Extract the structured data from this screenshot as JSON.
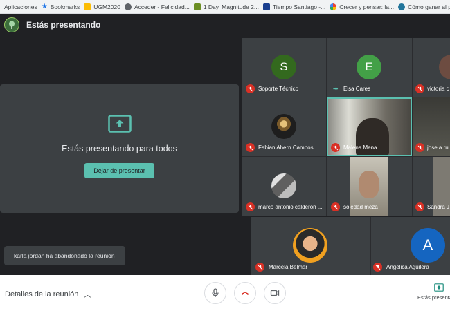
{
  "bookmarks": [
    {
      "label": "Aplicaciones",
      "icon": "apps-grid-icon"
    },
    {
      "label": "Bookmarks",
      "icon": "star-icon"
    },
    {
      "label": "UGM2020",
      "icon": "folder-icon"
    },
    {
      "label": "Acceder - Felicidad...",
      "icon": "site-favicon-icon"
    },
    {
      "label": "1 Day, Magnitude 2...",
      "icon": "earthquake-favicon-icon"
    },
    {
      "label": "Tiempo Santiago -...",
      "icon": "weather-favicon-icon"
    },
    {
      "label": "Crecer y pensar: la...",
      "icon": "google-icon"
    },
    {
      "label": "Cómo ganar al pied...",
      "icon": "wordpress-icon"
    }
  ],
  "topbar": {
    "title": "Estás presentando"
  },
  "presenting": {
    "message": "Estás presentando para todos",
    "stop_label": "Dejar de presentar"
  },
  "toast": {
    "text": "karla jordan ha abandonado la reunión"
  },
  "participants": [
    {
      "name": "Soporte Técnico",
      "initial": "S",
      "color": "#33691e",
      "muted": true
    },
    {
      "name": "Elsa Cares",
      "initial": "E",
      "color": "#43a047",
      "muted": false,
      "speaking": true
    },
    {
      "name": "victoria c",
      "initial": "",
      "color": "",
      "muted": true
    },
    {
      "name": "Fabian Ahern Campos",
      "muted": true,
      "photo": true
    },
    {
      "name": "Malena Mena",
      "muted": true,
      "video": true
    },
    {
      "name": "jose a ru",
      "muted": true,
      "video": true
    },
    {
      "name": "marco antonio calderon ...",
      "muted": true,
      "photo": true
    },
    {
      "name": "soledad meza",
      "muted": true,
      "video": true
    },
    {
      "name": "Sandra J",
      "muted": true,
      "video": true
    },
    {
      "name": "Marcela Belmar",
      "muted": true,
      "photo": true
    },
    {
      "name": "Angelica Aguilera",
      "initial": "A",
      "color": "#1565c0",
      "muted": true
    }
  ],
  "bottom": {
    "details_label": "Detalles de la reunión",
    "present_label": "Estás presentando"
  },
  "colors": {
    "accent": "#5bc0b0",
    "mute_red": "#d93025",
    "bg": "#202124"
  }
}
